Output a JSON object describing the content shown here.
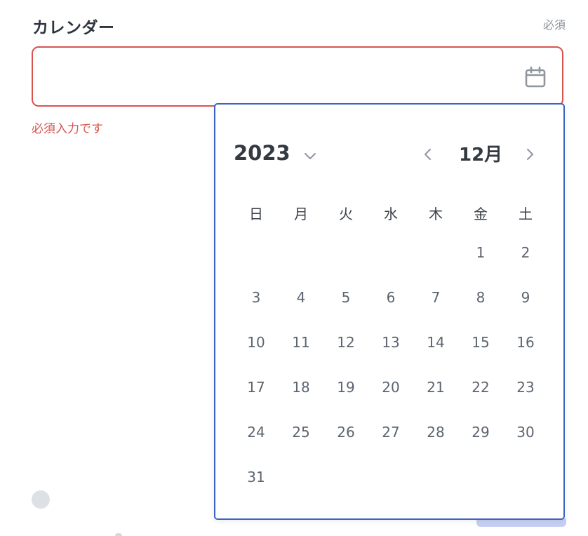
{
  "field": {
    "label": "カレンダー",
    "required_hint": "必須",
    "error_message": "必須入力です",
    "value": "",
    "icon": "calendar-icon"
  },
  "picker": {
    "year": "2023",
    "month": "12月",
    "weekdays": [
      "日",
      "月",
      "火",
      "水",
      "木",
      "金",
      "土"
    ],
    "days": [
      [
        "",
        "",
        "",
        "",
        "",
        "1",
        "2"
      ],
      [
        "3",
        "4",
        "5",
        "6",
        "7",
        "8",
        "9"
      ],
      [
        "10",
        "11",
        "12",
        "13",
        "14",
        "15",
        "16"
      ],
      [
        "17",
        "18",
        "19",
        "20",
        "21",
        "22",
        "23"
      ],
      [
        "24",
        "25",
        "26",
        "27",
        "28",
        "29",
        "30"
      ],
      [
        "31",
        "",
        "",
        "",
        "",
        "",
        ""
      ]
    ],
    "icons": {
      "year_dropdown": "chevron-down-icon",
      "prev": "chevron-left-icon",
      "next": "chevron-right-icon"
    }
  },
  "colors": {
    "error": "#d9534f",
    "picker_border": "#3b63c4",
    "day_text": "#5b6470"
  }
}
